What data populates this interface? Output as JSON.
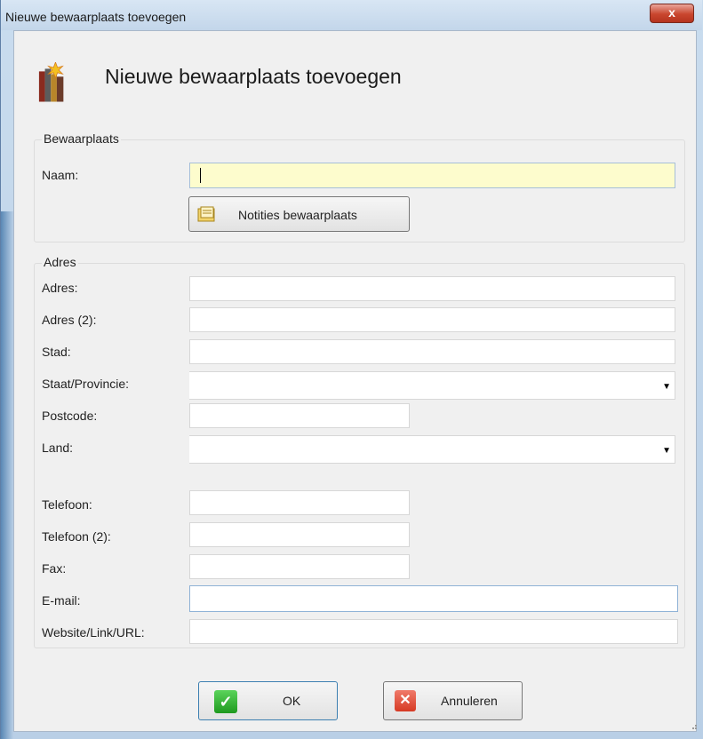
{
  "window": {
    "title": "Nieuwe bewaarplaats toevoegen",
    "close_label": "x"
  },
  "header": {
    "title": "Nieuwe bewaarplaats toevoegen",
    "icon": "books-star-icon"
  },
  "bewaarplaats_group": {
    "title": "Bewaarplaats",
    "naam_label": "Naam:",
    "naam_value": "",
    "notes_button_label": "Notities bewaarplaats",
    "notes_button_icon": "folder-notes-icon"
  },
  "adres_group": {
    "title": "Adres",
    "fields": {
      "adres_label": "Adres:",
      "adres2_label": "Adres (2):",
      "stad_label": "Stad:",
      "staat_label": "Staat/Provincie:",
      "postcode_label": "Postcode:",
      "land_label": "Land:",
      "telefoon_label": "Telefoon:",
      "telefoon2_label": "Telefoon (2):",
      "fax_label": "Fax:",
      "email_label": "E-mail:",
      "website_label": "Website/Link/URL:"
    }
  },
  "buttons": {
    "ok_label": "OK",
    "cancel_label": "Annuleren"
  },
  "colors": {
    "name_field_bg": "#fdfccd",
    "dialog_bg": "#f0f0f0",
    "close_button": "#c9462e",
    "ok_icon": "#1f9a1f",
    "cancel_icon": "#d63a24"
  }
}
